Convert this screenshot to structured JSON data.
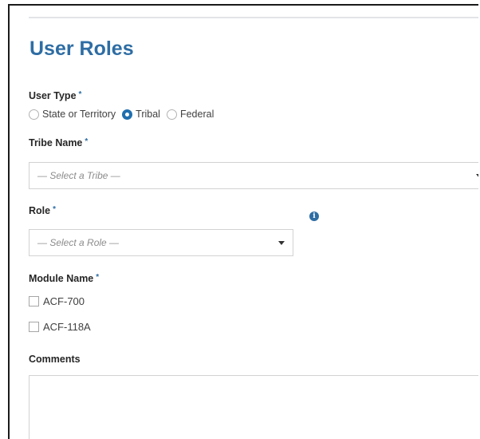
{
  "form": {
    "title": "User Roles",
    "required_marker": "*",
    "user_type": {
      "label": "User Type",
      "options": [
        "State or Territory",
        "Tribal",
        "Federal"
      ],
      "selected": "Tribal"
    },
    "tribe_name": {
      "label": "Tribe Name",
      "placeholder": "— Select a Tribe —"
    },
    "role": {
      "label": "Role",
      "placeholder": "— Select a Role —",
      "info_icon": "info-icon"
    },
    "module_name": {
      "label": "Module Name",
      "options": [
        "ACF-700",
        "ACF-118A"
      ]
    },
    "comments": {
      "label": "Comments",
      "value": ""
    }
  },
  "colors": {
    "accent": "#2e6da4",
    "radio_selected": "#1f6fae"
  }
}
